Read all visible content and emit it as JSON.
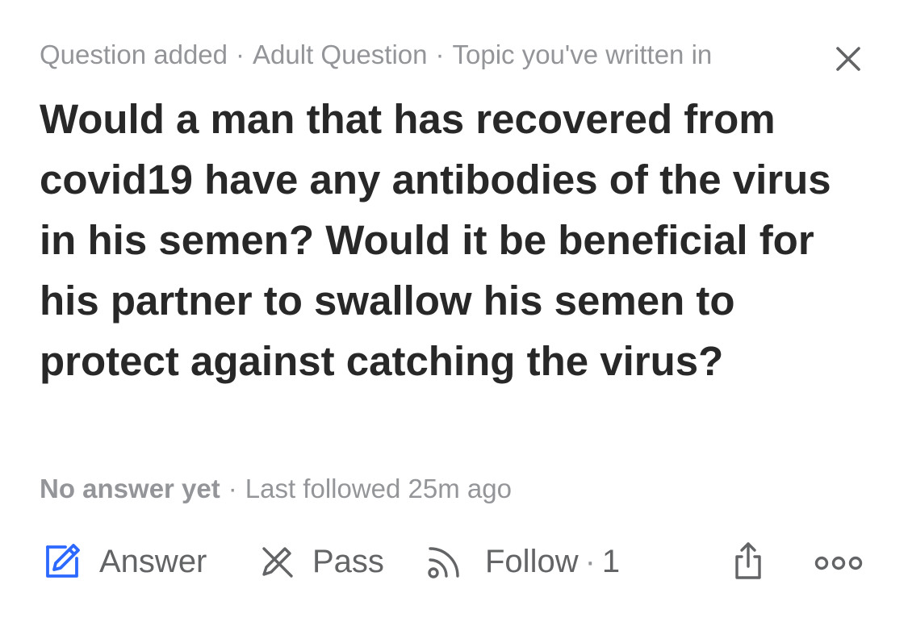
{
  "meta": {
    "item1": "Question added",
    "item2": "Adult Question",
    "item3": "Topic you've written in",
    "separator": "·",
    "close_icon": "close-icon"
  },
  "question": {
    "title": "Would a man that has recovered from covid19 have any antibodies of the virus in his semen? Would it be beneficial for his partner to swallow his semen to protect against catching the virus?"
  },
  "status": {
    "answer_status": "No answer yet",
    "separator": "·",
    "last_followed": "Last followed 25m ago"
  },
  "actions": {
    "answer_label": "Answer",
    "answer_icon": "pencil-icon",
    "pass_label": "Pass",
    "pass_icon": "pass-icon",
    "follow_label": "Follow",
    "follow_separator": "·",
    "follow_count": "1",
    "follow_icon": "rss-icon",
    "share_icon": "share-icon",
    "more_icon": "more-icon"
  },
  "colors": {
    "accent_blue": "#2e69ff",
    "text_primary": "#282829",
    "text_secondary": "#939598",
    "icon_gray": "#636466"
  }
}
